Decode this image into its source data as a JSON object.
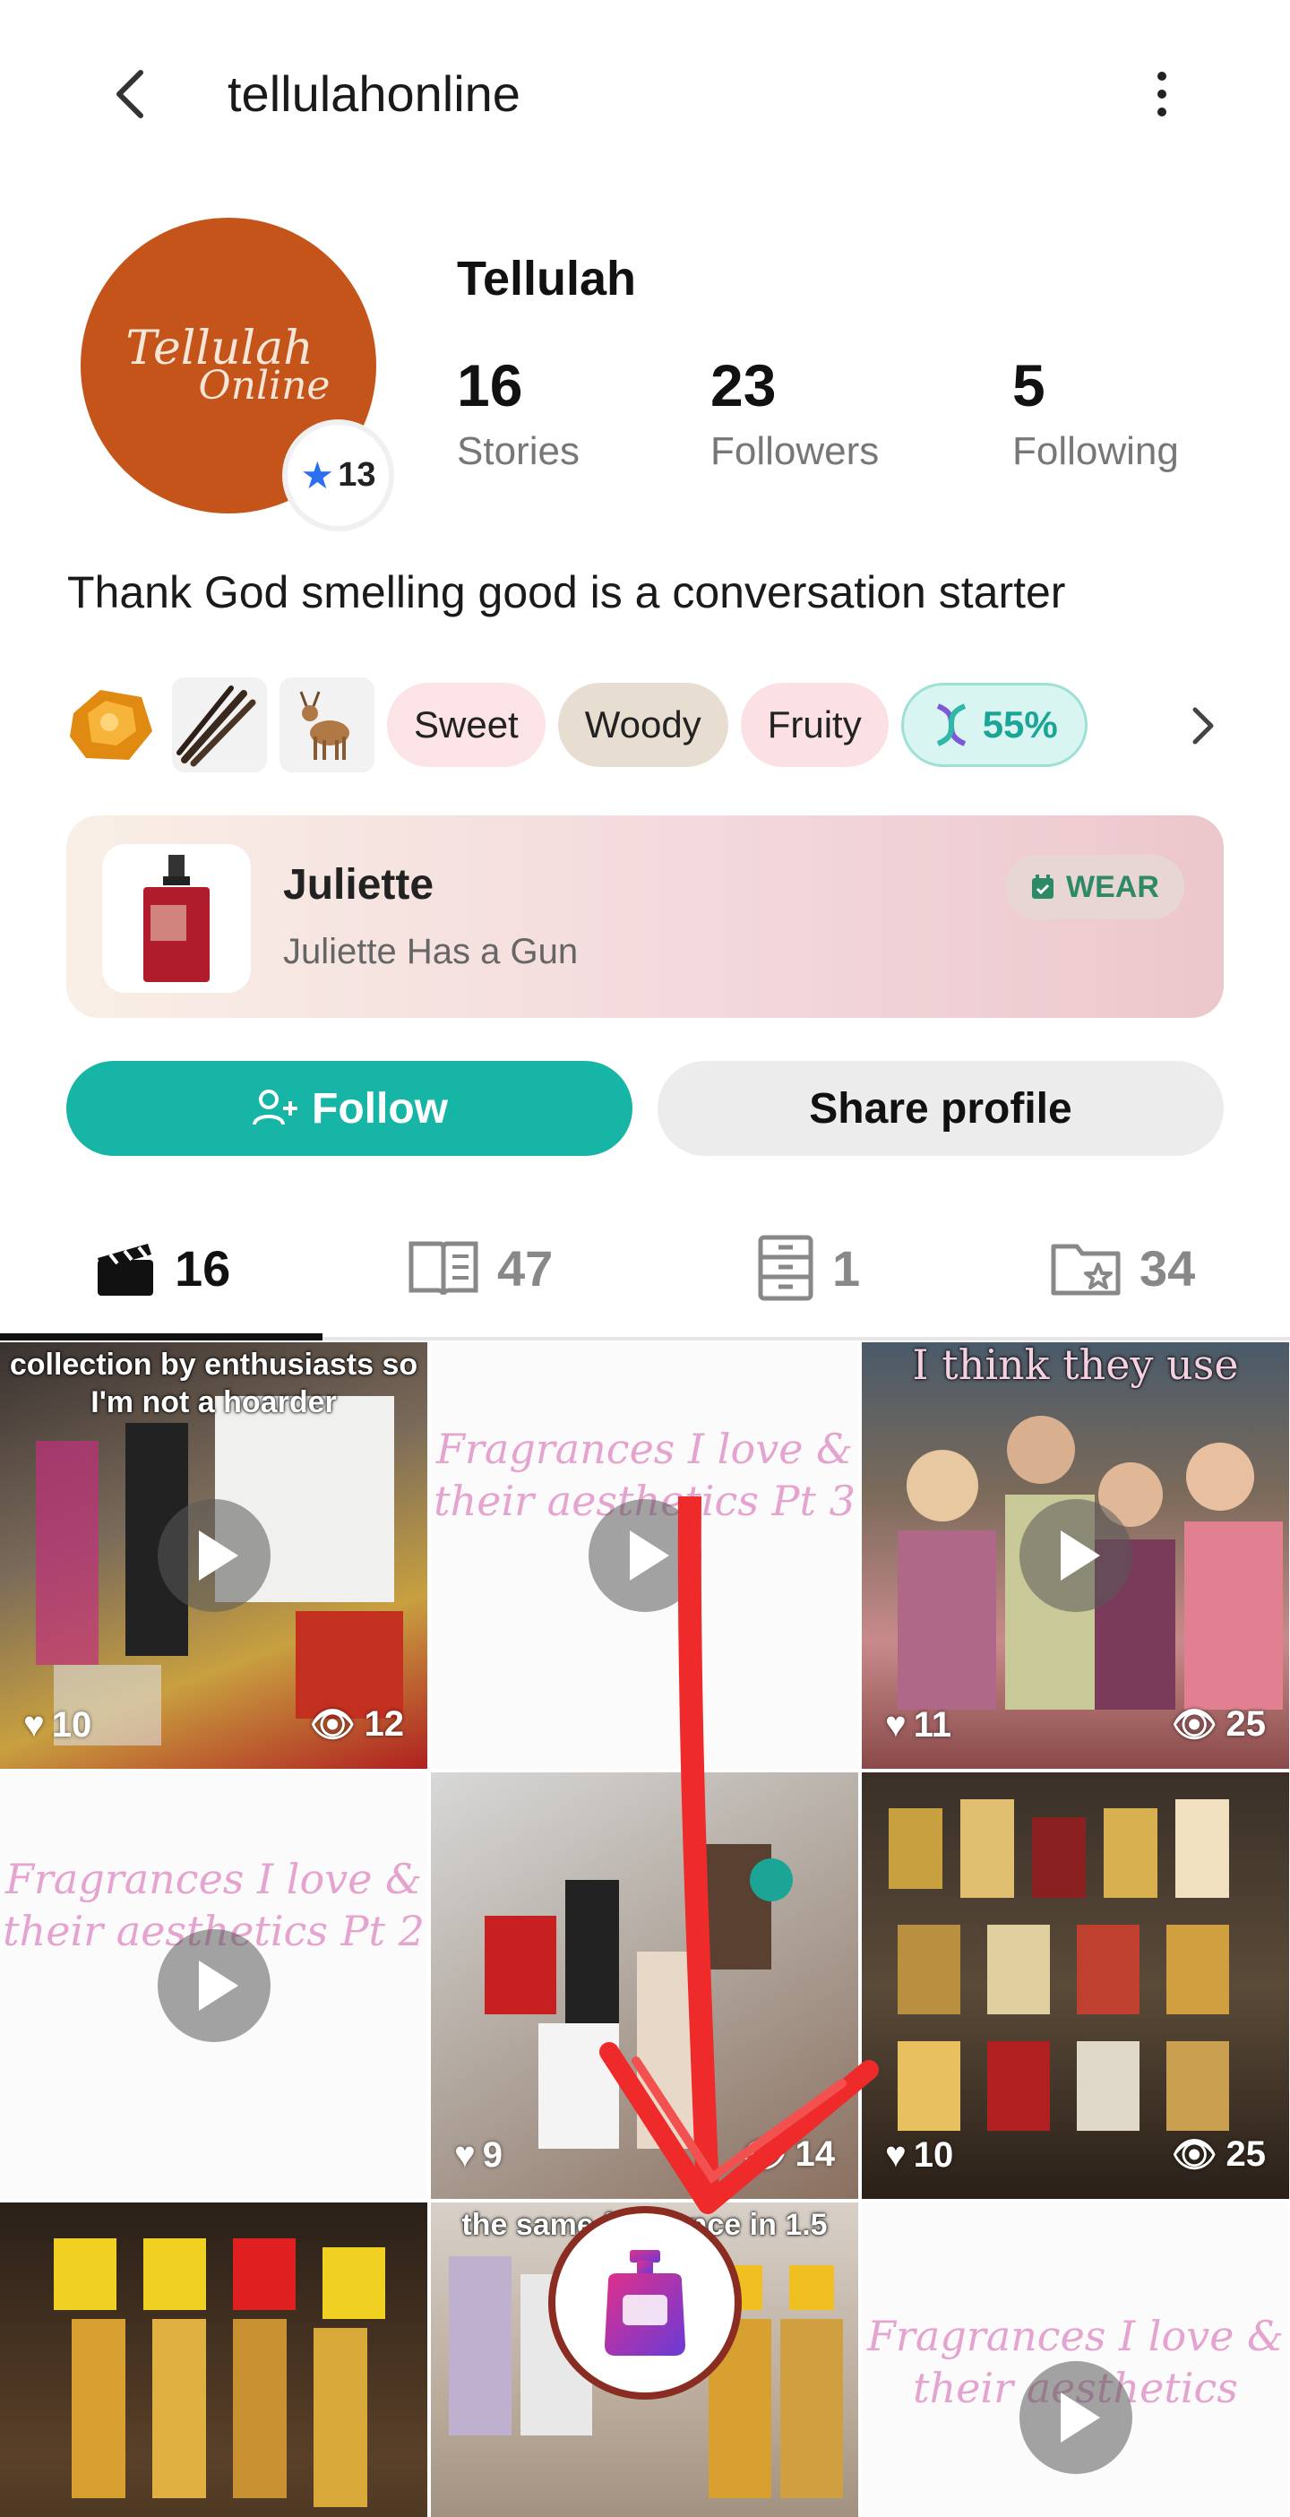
{
  "header": {
    "title": "tellulahonline"
  },
  "profile": {
    "avatar_line1": "Tellulah",
    "avatar_line2": "Online",
    "level": "13",
    "display_name": "Tellulah",
    "stats": [
      {
        "value": "16",
        "label": "Stories"
      },
      {
        "value": "23",
        "label": "Followers"
      },
      {
        "value": "5",
        "label": "Following"
      }
    ],
    "bio": "Thank God smelling good is a conversation starter"
  },
  "tags": {
    "image_icons": [
      "amber-icon",
      "vanilla-icon",
      "deer-icon"
    ],
    "pills": [
      "Sweet",
      "Woody",
      "Fruity"
    ],
    "dna_percent": "55%"
  },
  "wearing": {
    "name": "Juliette",
    "brand": "Juliette Has a Gun",
    "badge": "WEAR"
  },
  "actions": {
    "follow": "Follow",
    "share": "Share profile"
  },
  "tabs": [
    {
      "icon": "clapperboard-icon",
      "count": "16"
    },
    {
      "icon": "book-icon",
      "count": "47"
    },
    {
      "icon": "cabinet-icon",
      "count": "1"
    },
    {
      "icon": "folder-star-icon",
      "count": "34"
    }
  ],
  "grid": [
    {
      "caption": "collection by enthusiasts so I'm not a hoarder",
      "likes": "10",
      "views": "12"
    },
    {
      "pink_text": "Fragrances I love & their aesthetics Pt 3",
      "likes": "",
      "views": ""
    },
    {
      "caption": "I think they use",
      "likes": "11",
      "views": "25"
    },
    {
      "pink_text": "Fragrances I love & their aesthetics Pt 2",
      "likes": "",
      "views": ""
    },
    {
      "caption": "",
      "likes": "9",
      "views": "14"
    },
    {
      "caption": "",
      "likes": "10",
      "views": "25"
    },
    {
      "caption": "",
      "likes": "",
      "views": ""
    },
    {
      "caption": "the same fragrance in 1.5 years)",
      "likes": "",
      "views": ""
    },
    {
      "pink_text": "Fragrances I love & their aesthetics",
      "likes": "",
      "views": ""
    }
  ],
  "colors": {
    "accent": "#16b5a5",
    "avatar_bg": "#c4541a",
    "level_star": "#2b6ef2"
  }
}
